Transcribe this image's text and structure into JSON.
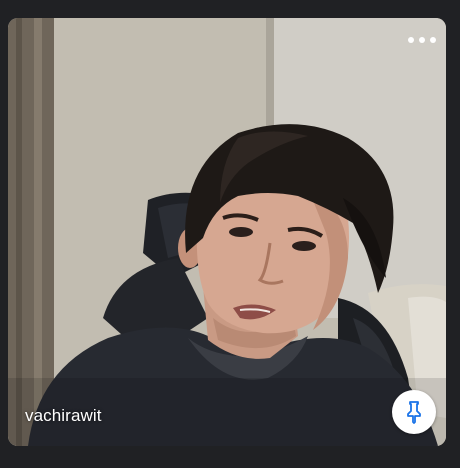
{
  "participant": {
    "name": "vachirawit"
  },
  "icons": {
    "more_options": "more-horiz-icon",
    "pin": "pin-icon"
  },
  "colors": {
    "background": "#202124",
    "pin_icon": "#1a73e8",
    "name_text": "#ffffff"
  }
}
